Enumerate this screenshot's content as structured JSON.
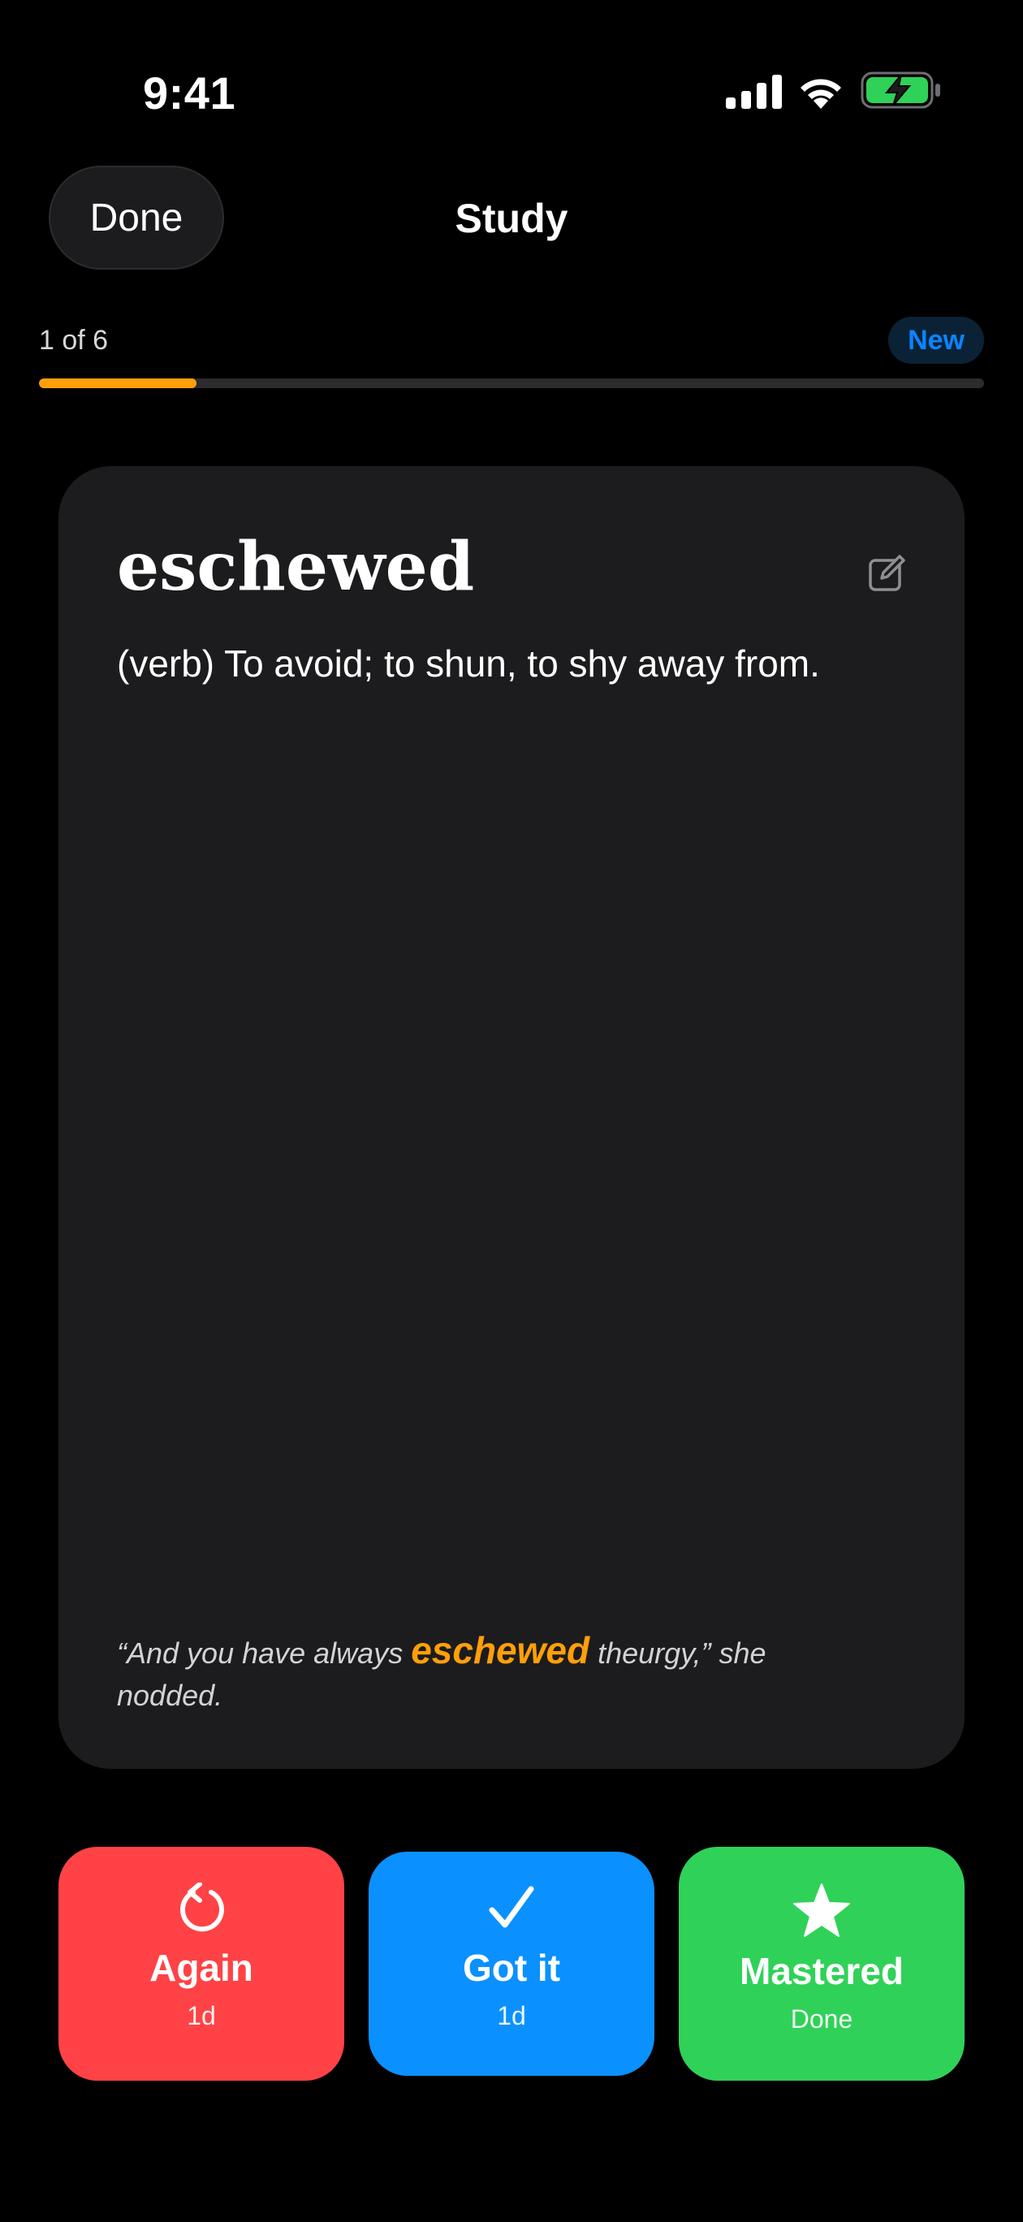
{
  "status_bar": {
    "time": "9:41",
    "icons": [
      "cellular-signal-icon",
      "wifi-icon",
      "battery-charging-icon"
    ]
  },
  "nav": {
    "done_label": "Done",
    "title": "Study"
  },
  "progress": {
    "counter": "1 of 6",
    "badge": "New",
    "fraction": 0.167
  },
  "card": {
    "word": "eschewed",
    "definition": "(verb) To avoid; to shun, to shy away from.",
    "example_before": "“And you have always ",
    "example_highlight": "eschewed",
    "example_after": " theurgy,” she nodded.",
    "edit_icon": "edit-icon"
  },
  "actions": [
    {
      "label": "Again",
      "sub": "1d",
      "icon": "retry-icon",
      "color": "#ff4245"
    },
    {
      "label": "Got it",
      "sub": "1d",
      "icon": "checkmark-icon",
      "color": "#0a91ff"
    },
    {
      "label": "Mastered",
      "sub": "Done",
      "icon": "star-icon",
      "color": "#30d158"
    }
  ],
  "colors": {
    "accent_orange": "#ff9f0a",
    "badge_blue": "#0a84ff",
    "card_bg": "#1c1c1e"
  }
}
